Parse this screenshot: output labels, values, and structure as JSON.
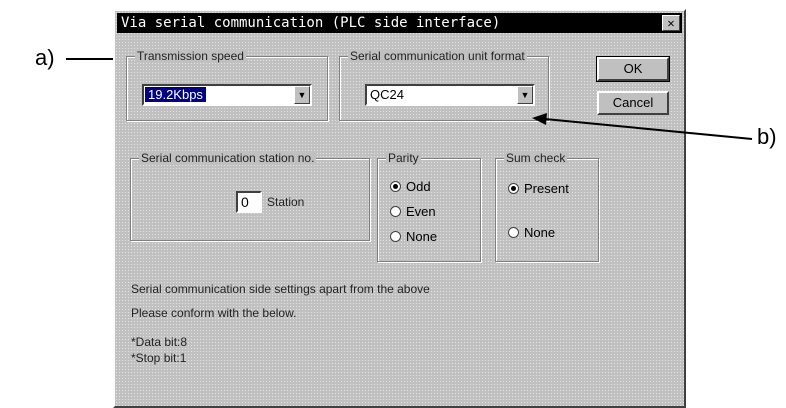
{
  "callouts": {
    "a": "a)",
    "b": "b)"
  },
  "dialog": {
    "title": "Via serial communication (PLC side interface)",
    "close_glyph": "✕",
    "transmission_speed": {
      "legend": "Transmission speed",
      "value": "19.2Kbps"
    },
    "unit_format": {
      "legend": "Serial communication unit format",
      "value": "QC24"
    },
    "buttons": {
      "ok": "OK",
      "cancel": "Cancel"
    },
    "station": {
      "legend": "Serial communication station no.",
      "value": "0",
      "suffix": "Station"
    },
    "parity": {
      "legend": "Parity",
      "options": [
        "Odd",
        "Even",
        "None"
      ],
      "selected": "Odd"
    },
    "sum_check": {
      "legend": "Sum check",
      "options": [
        "Present",
        "None"
      ],
      "selected": "Present"
    },
    "notes": {
      "line1": "Serial communication side settings apart from the above",
      "line2": "Please conform with the below.",
      "line3": "*Data bit:8",
      "line4": "*Stop bit:1"
    }
  },
  "icons": {
    "dropdown": "chevron-down-icon",
    "close": "close-icon",
    "arrow": "arrow-icon"
  },
  "colors": {
    "titlebar": "#000000",
    "face": "#c0c0c0",
    "selection": "#000080"
  }
}
